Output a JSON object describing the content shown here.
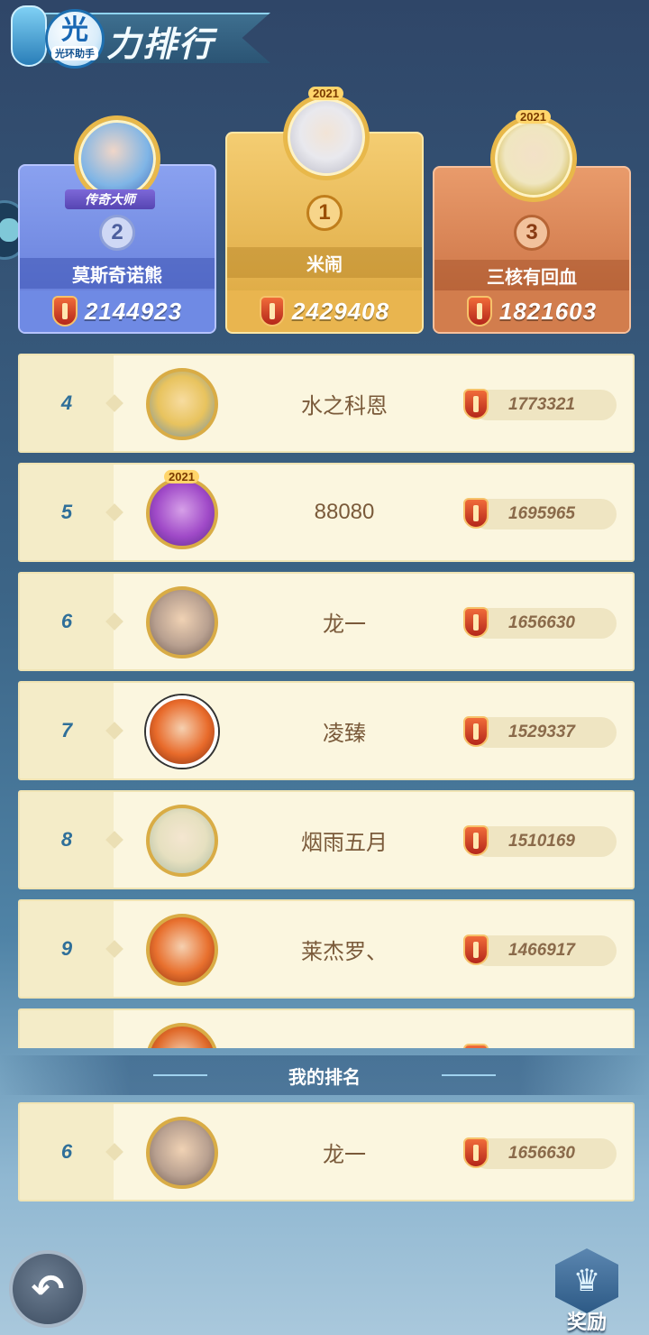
{
  "header": {
    "logo_char": "光",
    "logo_sub": "光环助手",
    "title": "力排行"
  },
  "podium": [
    {
      "rank": "2",
      "name": "莫斯奇诺熊",
      "score": "2144923",
      "title_badge": "传奇大师"
    },
    {
      "rank": "1",
      "name": "米闹",
      "score": "2429408",
      "year_badge": "2021"
    },
    {
      "rank": "3",
      "name": "三核有回血",
      "score": "1821603",
      "year_badge": "2021"
    }
  ],
  "list": [
    {
      "rank": "4",
      "name": "水之科恩",
      "score": "1773321"
    },
    {
      "rank": "5",
      "name": "88080",
      "score": "1695965",
      "year_badge": "2021"
    },
    {
      "rank": "6",
      "name": "龙一",
      "score": "1656630"
    },
    {
      "rank": "7",
      "name": "凌臻",
      "score": "1529337"
    },
    {
      "rank": "8",
      "name": "烟雨五月",
      "score": "1510169"
    },
    {
      "rank": "9",
      "name": "莱杰罗、",
      "score": "1466917"
    }
  ],
  "my_rank": {
    "section_label": "我的排名",
    "rank": "6",
    "name": "龙一",
    "score": "1656630"
  },
  "footer": {
    "back_icon": "↶",
    "reward_icon": "♛",
    "reward_label": "奖励"
  },
  "colors": {
    "first": "#e9b54f",
    "second": "#6f8ae4",
    "third": "#d27d4d",
    "rank_text": "#2f6f99"
  }
}
